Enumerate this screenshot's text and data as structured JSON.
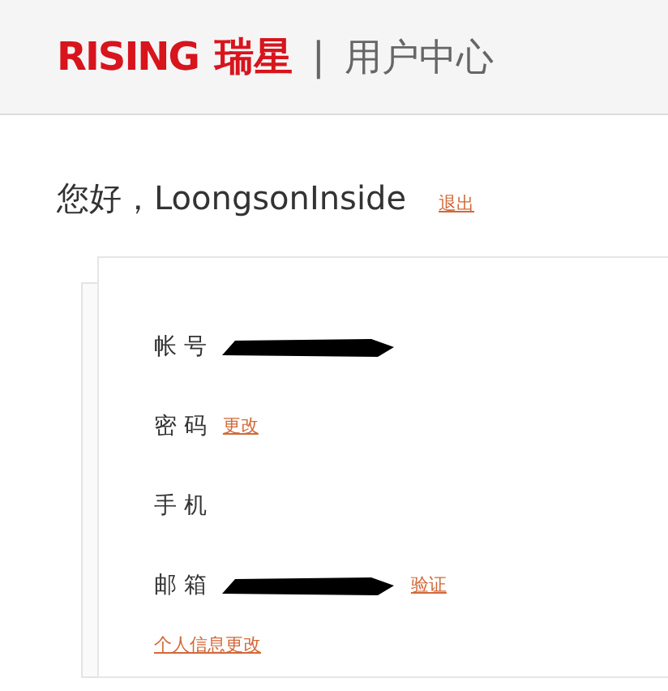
{
  "header": {
    "logo_latin": "RISING",
    "logo_chinese": "瑞星",
    "separator": "|",
    "title": "用户中心"
  },
  "greeting": {
    "text": "您好，LoongsonInside",
    "logout_link": "退出"
  },
  "account_fields": [
    {
      "label": "帐 号",
      "redacted": true
    },
    {
      "label": "密 码",
      "link": "更改"
    },
    {
      "label": "手 机"
    },
    {
      "label": "邮 箱",
      "redacted": true,
      "link": "验证"
    }
  ],
  "edit_profile_link": "个人信息更改"
}
